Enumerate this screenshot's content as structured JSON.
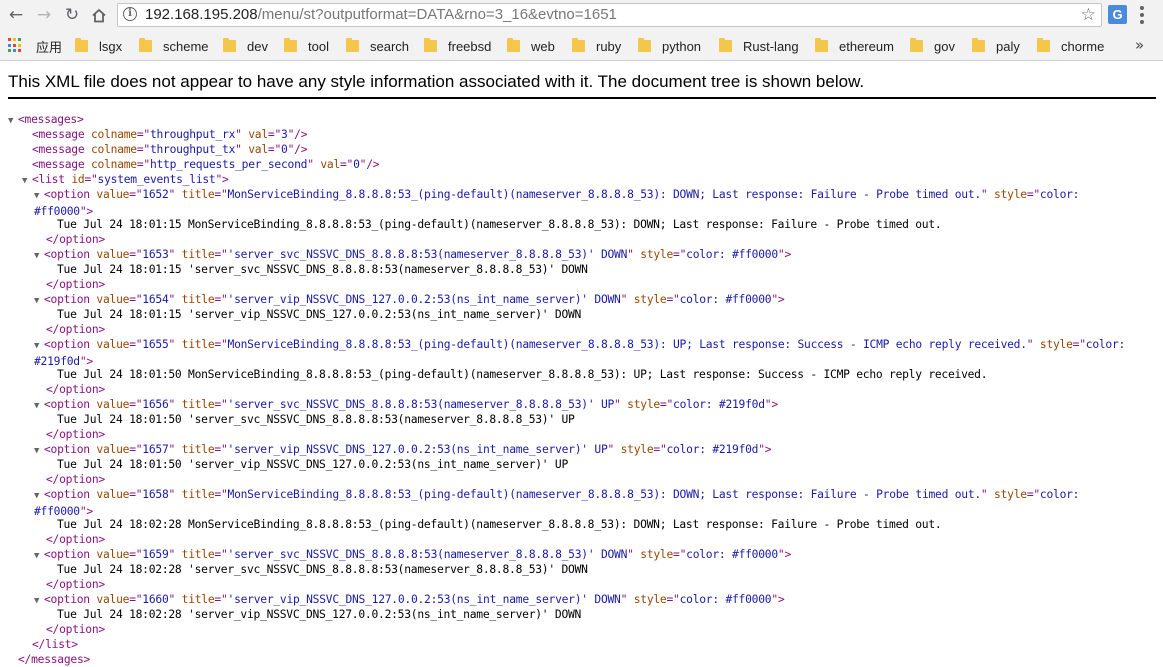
{
  "browser": {
    "url_host": "192.168.195.208",
    "url_path": "/menu/st?outputformat=DATA&rno=3_16&evtno=1651",
    "icons": {
      "back": "back-arrow-icon",
      "forward": "forward-arrow-icon",
      "reload": "reload-icon",
      "home": "home-icon",
      "info": "info-icon",
      "star": "bookmark-star-icon",
      "translate": "google-translate-icon",
      "menu": "kebab-menu-icon"
    },
    "translate_label": "G",
    "apps_label": "应用",
    "bookmarks": [
      "lsgx",
      "scheme",
      "dev",
      "tool",
      "search",
      "freebsd",
      "web",
      "ruby",
      "python",
      "Rust-lang",
      "ethereum",
      "gov",
      "paly",
      "chorme"
    ],
    "more": "»"
  },
  "colors": {
    "down": "#ff0000",
    "up": "#219f0d"
  },
  "page": {
    "notice": "This XML file does not appear to have any style information associated with it. The document tree is shown below."
  },
  "xml": {
    "root": "messages",
    "messages": [
      {
        "colname": "throughput_rx",
        "val": "3"
      },
      {
        "colname": "throughput_tx",
        "val": "0"
      },
      {
        "colname": "http_requests_per_second",
        "val": "0"
      }
    ],
    "list_id": "system_events_list",
    "options": [
      {
        "value": "1652",
        "title": "MonServiceBinding_8.8.8.8:53_(ping-default)(nameserver_8.8.8.8_53): DOWN; Last response: Failure - Probe timed out.",
        "style": "color: #ff0000",
        "text": "Tue Jul 24 18:01:15 MonServiceBinding_8.8.8.8:53_(ping-default)(nameserver_8.8.8.8_53): DOWN; Last response: Failure - Probe timed out."
      },
      {
        "value": "1653",
        "title": "'server_svc_NSSVC_DNS_8.8.8.8:53(nameserver_8.8.8.8_53)' DOWN",
        "style": "color: #ff0000",
        "text": "Tue Jul 24 18:01:15 'server_svc_NSSVC_DNS_8.8.8.8:53(nameserver_8.8.8.8_53)' DOWN"
      },
      {
        "value": "1654",
        "title": "'server_vip_NSSVC_DNS_127.0.0.2:53(ns_int_name_server)' DOWN",
        "style": "color: #ff0000",
        "text": "Tue Jul 24 18:01:15 'server_vip_NSSVC_DNS_127.0.0.2:53(ns_int_name_server)' DOWN"
      },
      {
        "value": "1655",
        "title": "MonServiceBinding_8.8.8.8:53_(ping-default)(nameserver_8.8.8.8_53): UP; Last response: Success - ICMP echo reply received.",
        "style": "color: #219f0d",
        "text": "Tue Jul 24 18:01:50 MonServiceBinding_8.8.8.8:53_(ping-default)(nameserver_8.8.8.8_53): UP; Last response: Success - ICMP echo reply received."
      },
      {
        "value": "1656",
        "title": "'server_svc_NSSVC_DNS_8.8.8.8:53(nameserver_8.8.8.8_53)' UP",
        "style": "color: #219f0d",
        "text": "Tue Jul 24 18:01:50 'server_svc_NSSVC_DNS_8.8.8.8:53(nameserver_8.8.8.8_53)' UP"
      },
      {
        "value": "1657",
        "title": "'server_vip_NSSVC_DNS_127.0.0.2:53(ns_int_name_server)' UP",
        "style": "color: #219f0d",
        "text": "Tue Jul 24 18:01:50 'server_vip_NSSVC_DNS_127.0.0.2:53(ns_int_name_server)' UP"
      },
      {
        "value": "1658",
        "title": "MonServiceBinding_8.8.8.8:53_(ping-default)(nameserver_8.8.8.8_53): DOWN; Last response: Failure - Probe timed out.",
        "style": "color: #ff0000",
        "text": "Tue Jul 24 18:02:28 MonServiceBinding_8.8.8.8:53_(ping-default)(nameserver_8.8.8.8_53): DOWN; Last response: Failure - Probe timed out."
      },
      {
        "value": "1659",
        "title": "'server_svc_NSSVC_DNS_8.8.8.8:53(nameserver_8.8.8.8_53)' DOWN",
        "style": "color: #ff0000",
        "text": "Tue Jul 24 18:02:28 'server_svc_NSSVC_DNS_8.8.8.8:53(nameserver_8.8.8.8_53)' DOWN"
      },
      {
        "value": "1660",
        "title": "'server_vip_NSSVC_DNS_127.0.0.2:53(ns_int_name_server)' DOWN",
        "style": "color: #ff0000",
        "text": "Tue Jul 24 18:02:28 'server_vip_NSSVC_DNS_127.0.0.2:53(ns_int_name_server)' DOWN"
      }
    ]
  }
}
